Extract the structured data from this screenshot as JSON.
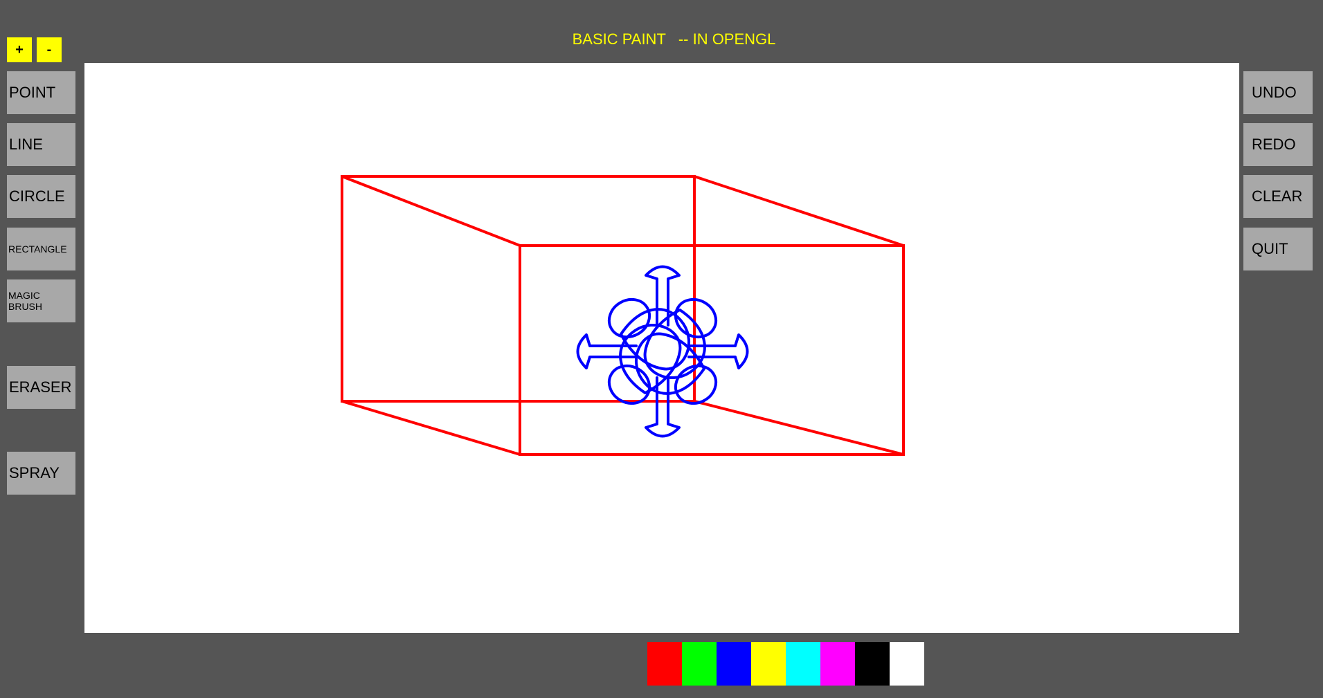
{
  "title": "BASIC PAINT   -- IN OPENGL",
  "size_controls": {
    "increase": "+",
    "decrease": "-"
  },
  "tools": {
    "point": "POINT",
    "line": "LINE",
    "circle": "CIRCLE",
    "rectangle": "RECTANGLE",
    "magic_brush": "MAGIC BRUSH",
    "eraser": "ERASER",
    "spray": "SPRAY"
  },
  "actions": {
    "undo": "UNDO",
    "redo": "REDO",
    "clear": "CLEAR",
    "quit": "QUIT"
  },
  "palette": [
    {
      "name": "red",
      "color": "#ff0000"
    },
    {
      "name": "green",
      "color": "#00ff00"
    },
    {
      "name": "blue",
      "color": "#0000ff"
    },
    {
      "name": "yellow",
      "color": "#ffff00"
    },
    {
      "name": "cyan",
      "color": "#00ffff"
    },
    {
      "name": "magenta",
      "color": "#ff00ff"
    },
    {
      "name": "black",
      "color": "#000000"
    },
    {
      "name": "white",
      "color": "#ffffff"
    }
  ],
  "colors": {
    "background": "#555555",
    "title": "#ffff00",
    "button": "#a8a8a8",
    "size_button": "#ffff00",
    "canvas": "#ffffff",
    "cube_stroke": "#ff0000",
    "flower_stroke": "#0000ff"
  }
}
